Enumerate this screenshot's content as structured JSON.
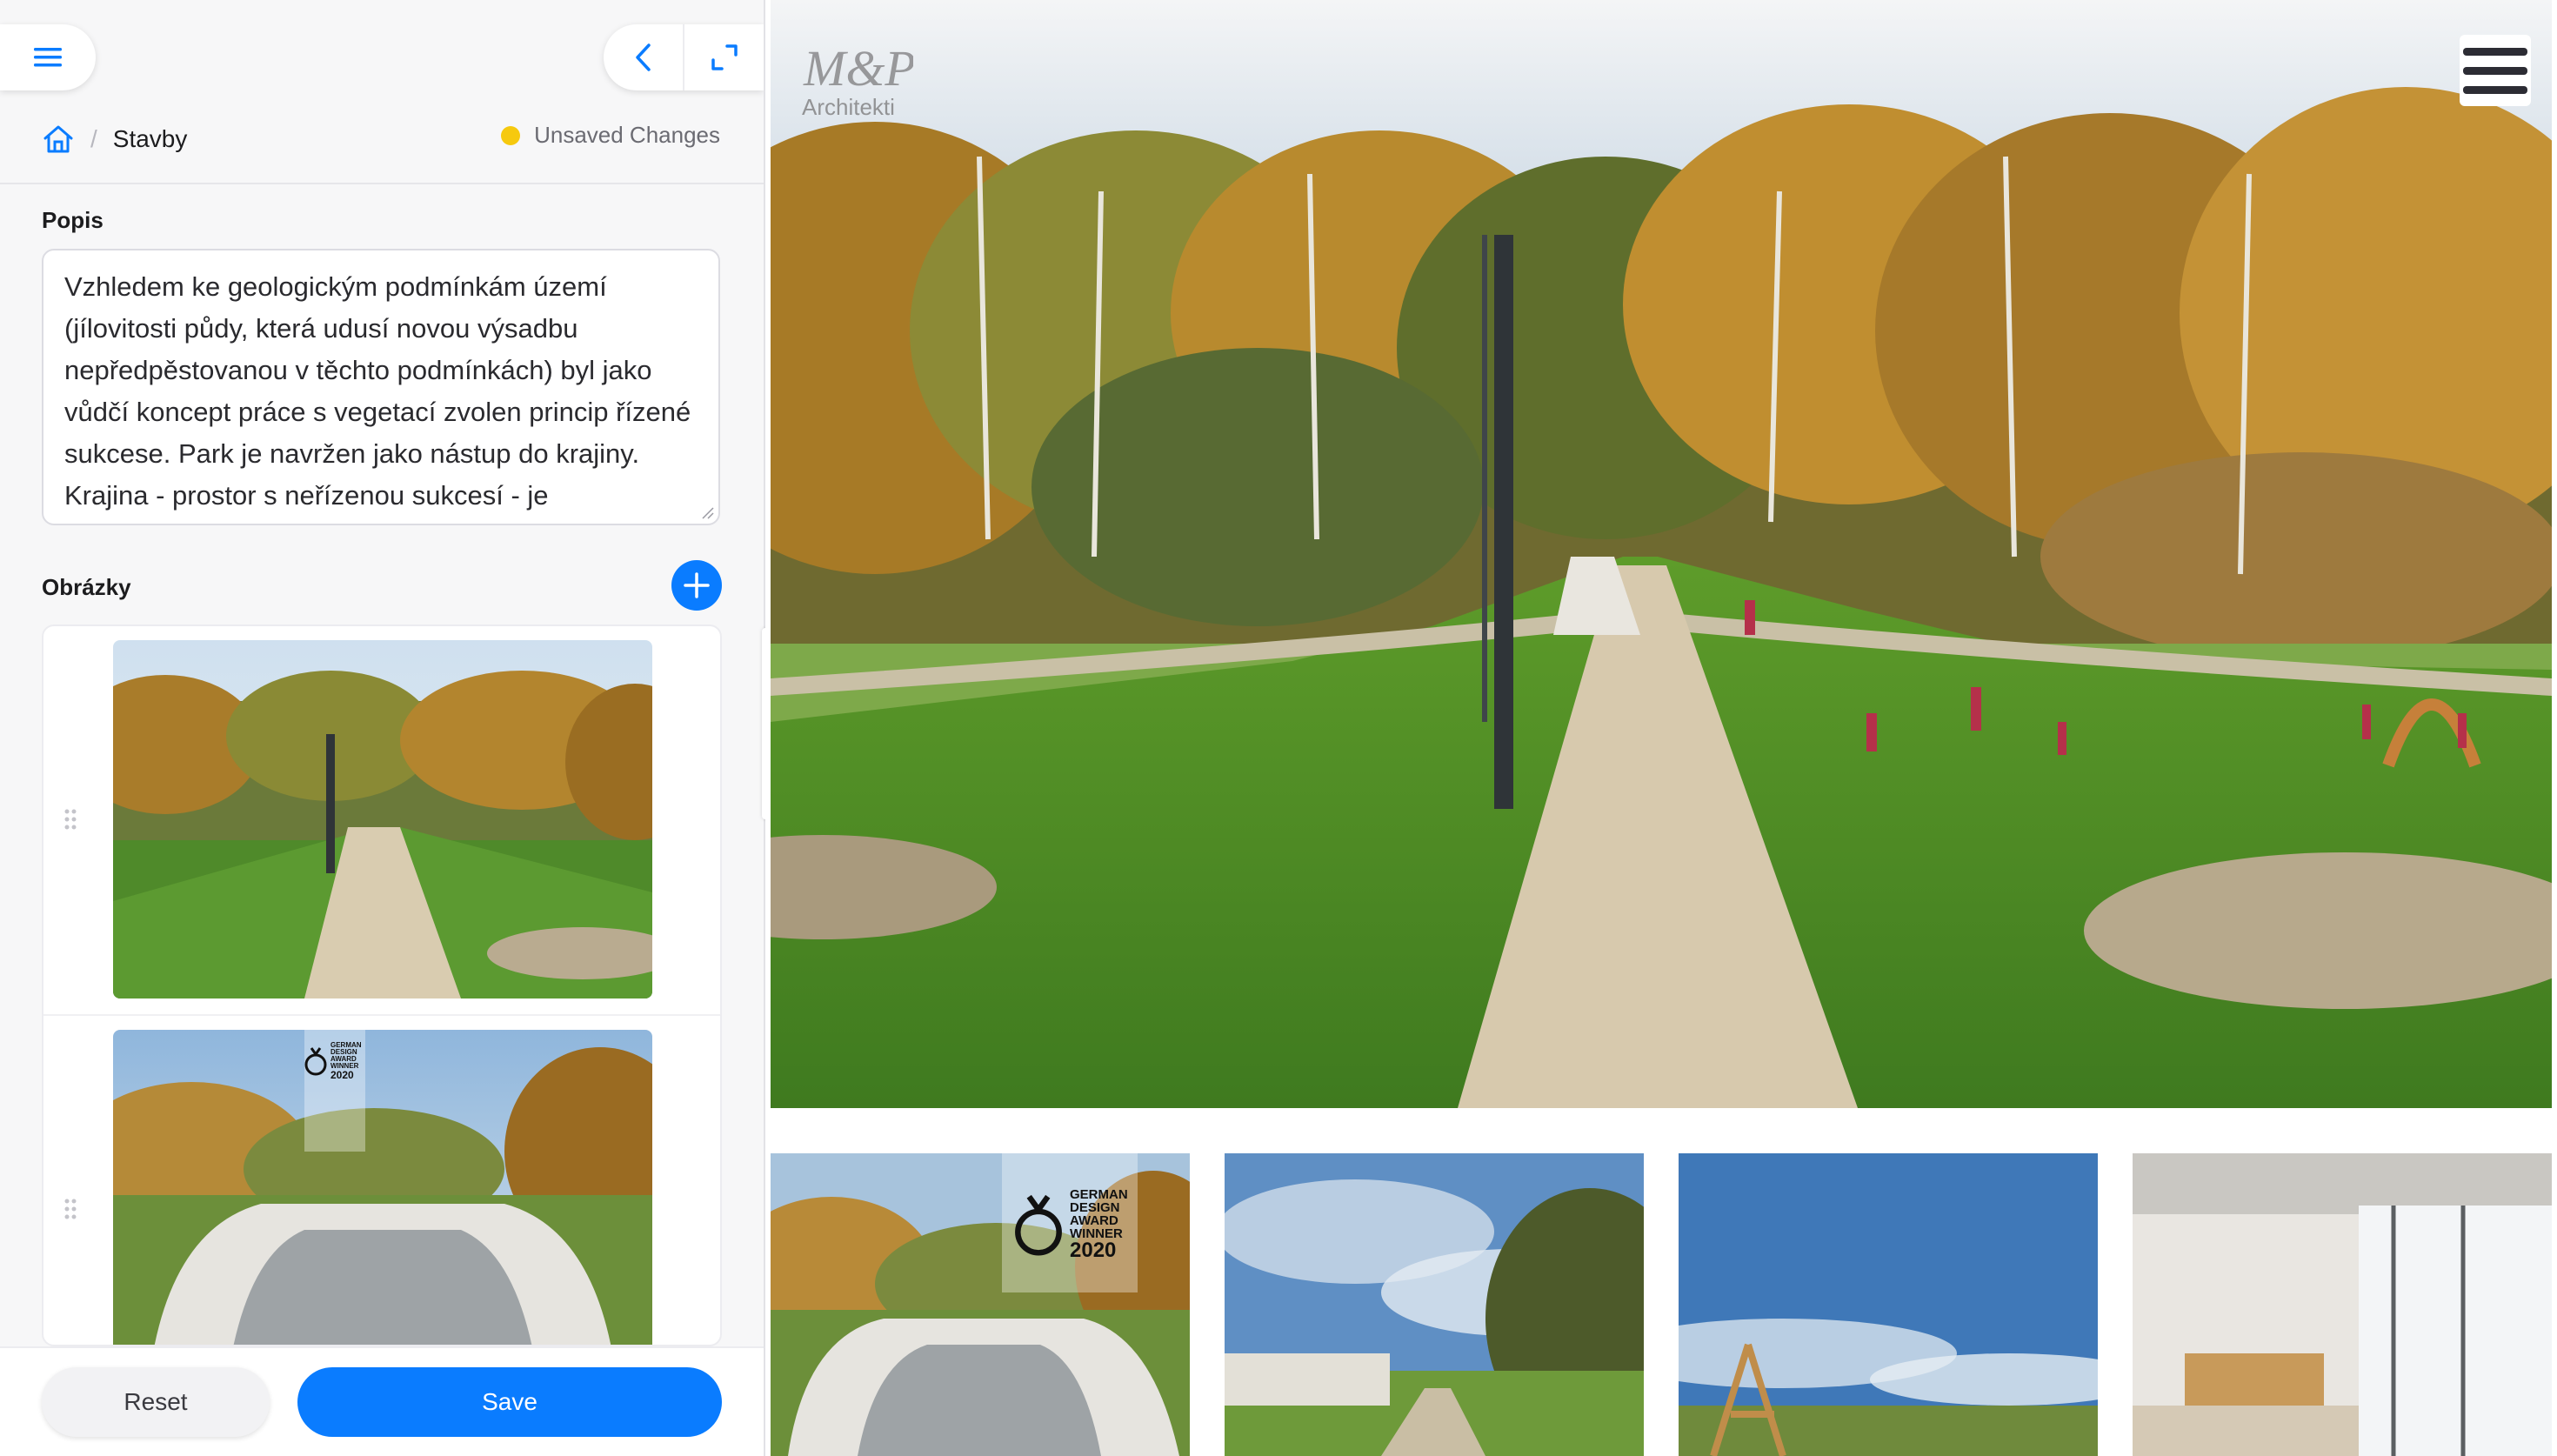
{
  "breadcrumb": {
    "current": "Stavby"
  },
  "status": {
    "unsaved_label": "Unsaved Changes"
  },
  "form": {
    "description_label": "Popis",
    "description_value": "Vzhledem ke geologickým podmínkám území (jílovitosti půdy, která udusí novou výsadbu nepředpěstovanou v těchto podmínkách) byl jako vůdčí koncept práce s vegetací zvolen princip řízené sukcese. Park je navržen jako nástup do krajiny. Krajina - prostor s neřízenou sukcesí - je",
    "images_label": "Obrázky"
  },
  "footer": {
    "reset_label": "Reset",
    "save_label": "Save"
  },
  "preview": {
    "logo_line1": "M&P",
    "logo_line2": "Architekti",
    "award_lines": [
      "GERMAN",
      "DESIGN",
      "AWARD",
      "WINNER",
      "2020"
    ]
  },
  "colors": {
    "accent": "#0a7cff",
    "unsaved_dot": "#f6c90e"
  },
  "icons": [
    "hamburger-icon",
    "chevron-left-icon",
    "expand-icon",
    "home-icon",
    "plus-icon",
    "drag-handle-icon"
  ]
}
